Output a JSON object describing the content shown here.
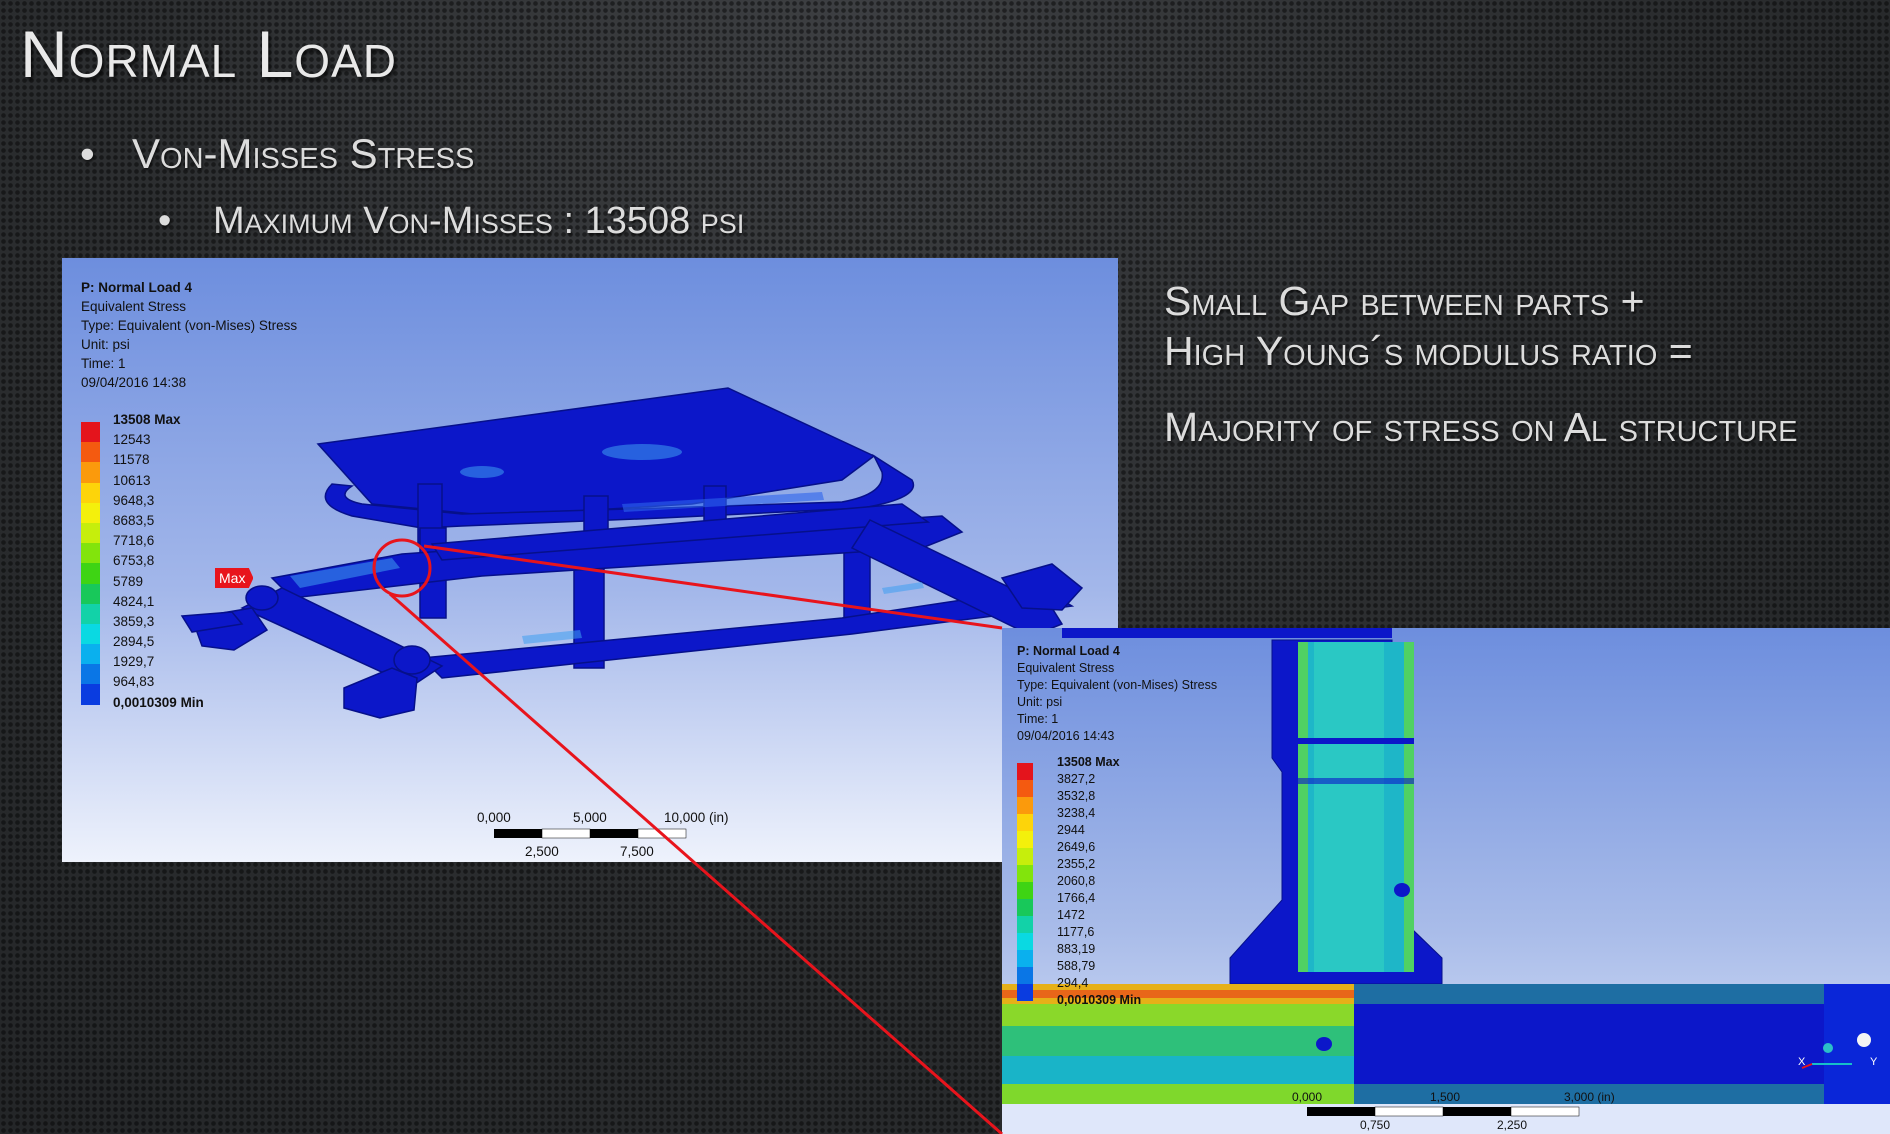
{
  "slide": {
    "title": "Normal Load",
    "bullet1": "Von-Misses Stress",
    "bullet2": "Maximum Von-Misses : 13508 psi",
    "bullet_glyph": "•"
  },
  "side_text": {
    "line1": "Small Gap between parts +",
    "line2": "High Young´s modulus ratio =",
    "line3": "Majority of stress on Al structure"
  },
  "sim_main": {
    "title": "P: Normal  Load 4",
    "result": "Equivalent Stress",
    "type": "Type: Equivalent (von-Mises) Stress",
    "unit": "Unit: psi",
    "time": "Time: 1",
    "date": "09/04/2016 14:38",
    "max_tag": "Max",
    "legend": [
      {
        "label": "13508 Max",
        "color": "#e4141c"
      },
      {
        "label": "12543",
        "color": "#f45a10"
      },
      {
        "label": "11578",
        "color": "#fb9a0c"
      },
      {
        "label": "10613",
        "color": "#fdd40a"
      },
      {
        "label": "9648,3",
        "color": "#f4f00c"
      },
      {
        "label": "8683,5",
        "color": "#c6ee0c"
      },
      {
        "label": "7718,6",
        "color": "#82e40c"
      },
      {
        "label": "6753,8",
        "color": "#3ed414"
      },
      {
        "label": "5789",
        "color": "#18c85a"
      },
      {
        "label": "4824,1",
        "color": "#12d2a8"
      },
      {
        "label": "3859,3",
        "color": "#0ad9e2"
      },
      {
        "label": "2894,5",
        "color": "#0ab0ee"
      },
      {
        "label": "1929,7",
        "color": "#0a76e6"
      },
      {
        "label": "964,83",
        "color": "#0a3ce0"
      },
      {
        "label": "0,0010309 Min",
        "color": "#0a10dc"
      }
    ],
    "scale": {
      "top": [
        "0,000",
        "5,000",
        "10,000 (in)"
      ],
      "bottom": [
        "2,500",
        "7,500"
      ]
    }
  },
  "sim_zoom": {
    "title": "P: Normal  Load 4",
    "result": "Equivalent Stress",
    "type": "Type: Equivalent (von-Mises) Stress",
    "unit": "Unit: psi",
    "time": "Time: 1",
    "date": "09/04/2016 14:43",
    "legend": [
      {
        "label": "13508 Max",
        "color": "#e4141c"
      },
      {
        "label": "3827,2",
        "color": "#f45a10"
      },
      {
        "label": "3532,8",
        "color": "#fb9a0c"
      },
      {
        "label": "3238,4",
        "color": "#fdd40a"
      },
      {
        "label": "2944",
        "color": "#f4f00c"
      },
      {
        "label": "2649,6",
        "color": "#c6ee0c"
      },
      {
        "label": "2355,2",
        "color": "#82e40c"
      },
      {
        "label": "2060,8",
        "color": "#3ed414"
      },
      {
        "label": "1766,4",
        "color": "#18c85a"
      },
      {
        "label": "1472",
        "color": "#12d2a8"
      },
      {
        "label": "1177,6",
        "color": "#0ad9e2"
      },
      {
        "label": "883,19",
        "color": "#0ab0ee"
      },
      {
        "label": "588,79",
        "color": "#0a76e6"
      },
      {
        "label": "294,4",
        "color": "#0a3ce0"
      },
      {
        "label": "0,0010309 Min",
        "color": "#0a10dc"
      }
    ],
    "scale": {
      "top": [
        "0,000",
        "1,500",
        "3,000 (in)"
      ],
      "bottom": [
        "0,750",
        "2,250"
      ]
    },
    "axes": {
      "x": "X",
      "y": "Y"
    }
  },
  "colors": {
    "callout": "#e8141c",
    "mesh_blue": "#0c17c9"
  }
}
